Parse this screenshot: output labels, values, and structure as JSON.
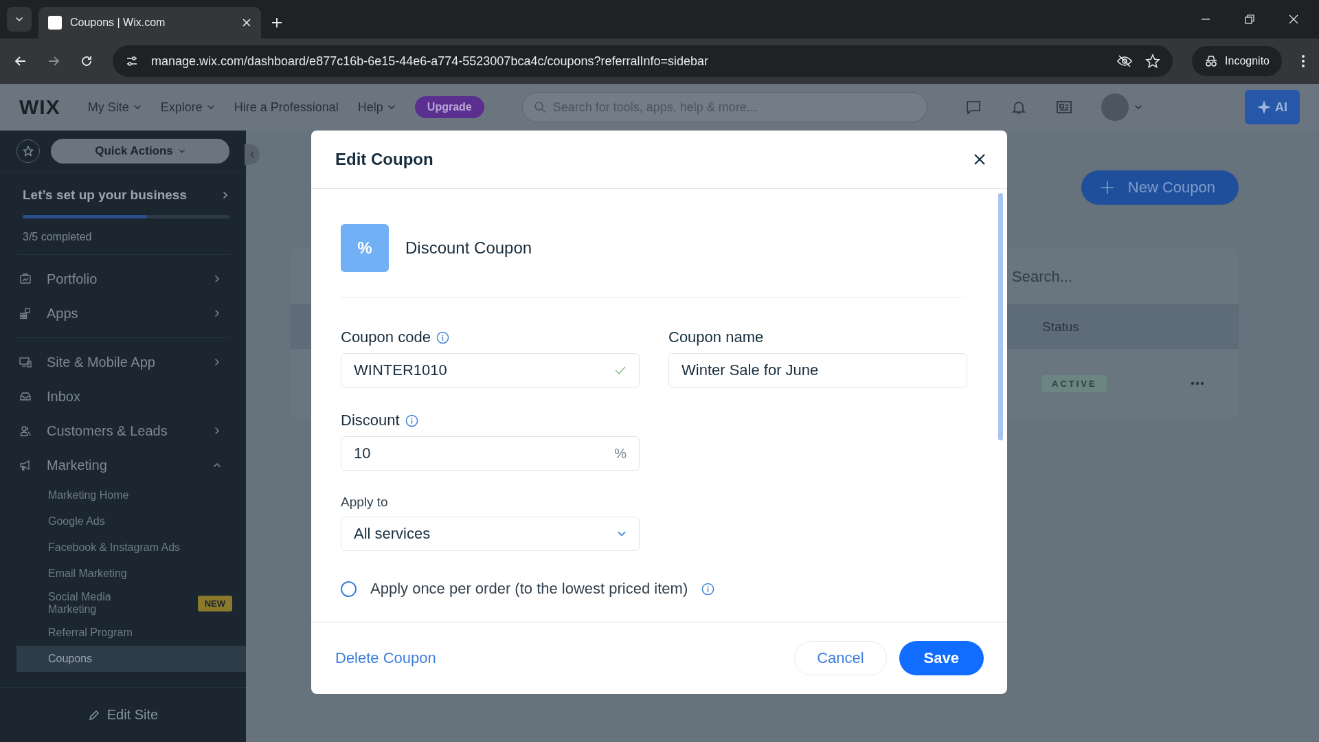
{
  "browser": {
    "tab_title": "Coupons | Wix.com",
    "url": "manage.wix.com/dashboard/e877c16b-6e15-44e6-a774-5523007bca4c/coupons?referralInfo=sidebar",
    "profile": "Incognito"
  },
  "topbar": {
    "logo": "WIX",
    "nav": [
      {
        "label": "My Site",
        "dropdown": true
      },
      {
        "label": "Explore",
        "dropdown": true
      },
      {
        "label": "Hire a Professional",
        "dropdown": false
      },
      {
        "label": "Help",
        "dropdown": true
      }
    ],
    "upgrade": "Upgrade",
    "search_placeholder": "Search for tools, apps, help & more...",
    "ai_label": "AI"
  },
  "sidebar": {
    "quick_actions": "Quick Actions",
    "setup": {
      "title": "Let’s set up your business",
      "level": 0.6,
      "progress_text": "3/5 completed"
    },
    "sections": [
      {
        "items": [
          {
            "label": "Portfolio",
            "kind": "portfolio",
            "chevron": true,
            "expanded": false
          },
          {
            "label": "Apps",
            "kind": "apps",
            "chevron": true,
            "expanded": false
          }
        ]
      },
      {
        "items": [
          {
            "label": "Site & Mobile App",
            "kind": "devices",
            "chevron": true,
            "expanded": false
          },
          {
            "label": "Inbox",
            "kind": "inbox",
            "chevron": false
          },
          {
            "label": "Customers & Leads",
            "kind": "people",
            "chevron": true,
            "expanded": false
          },
          {
            "label": "Marketing",
            "kind": "megaphone",
            "chevron": true,
            "expanded": true,
            "children": [
              {
                "label": "Marketing Home",
                "selected": false
              },
              {
                "label": "Google Ads",
                "selected": false
              },
              {
                "label": "Facebook & Instagram Ads",
                "selected": false
              },
              {
                "label": "Email Marketing",
                "selected": false
              },
              {
                "label": "Social Media Marketing",
                "badge": "NEW",
                "selected": false
              },
              {
                "label": "Referral Program",
                "selected": false
              },
              {
                "label": "Coupons",
                "selected": true
              }
            ]
          }
        ]
      }
    ],
    "edit_site": "Edit Site"
  },
  "page": {
    "new_button": "New Coupon",
    "search_placeholder": "Search...",
    "columns": [
      "Status"
    ],
    "rows": [
      {
        "status": "ACTIVE"
      }
    ]
  },
  "modal": {
    "title": "Edit Coupon",
    "type_icon": "%",
    "type_label": "Discount Coupon",
    "coupon_code": {
      "label": "Coupon code",
      "value": "WINTER1010",
      "valid": true
    },
    "coupon_name": {
      "label": "Coupon name",
      "value": "Winter Sale for June"
    },
    "discount": {
      "label": "Discount",
      "value": "10",
      "suffix": "%"
    },
    "apply_to": {
      "label": "Apply to",
      "value": "All services"
    },
    "once_per_order": {
      "label": "Apply once per order (to the lowest priced item)",
      "selected": false
    },
    "delete_button": "Delete Coupon",
    "cancel_button": "Cancel",
    "save_button": "Save"
  }
}
